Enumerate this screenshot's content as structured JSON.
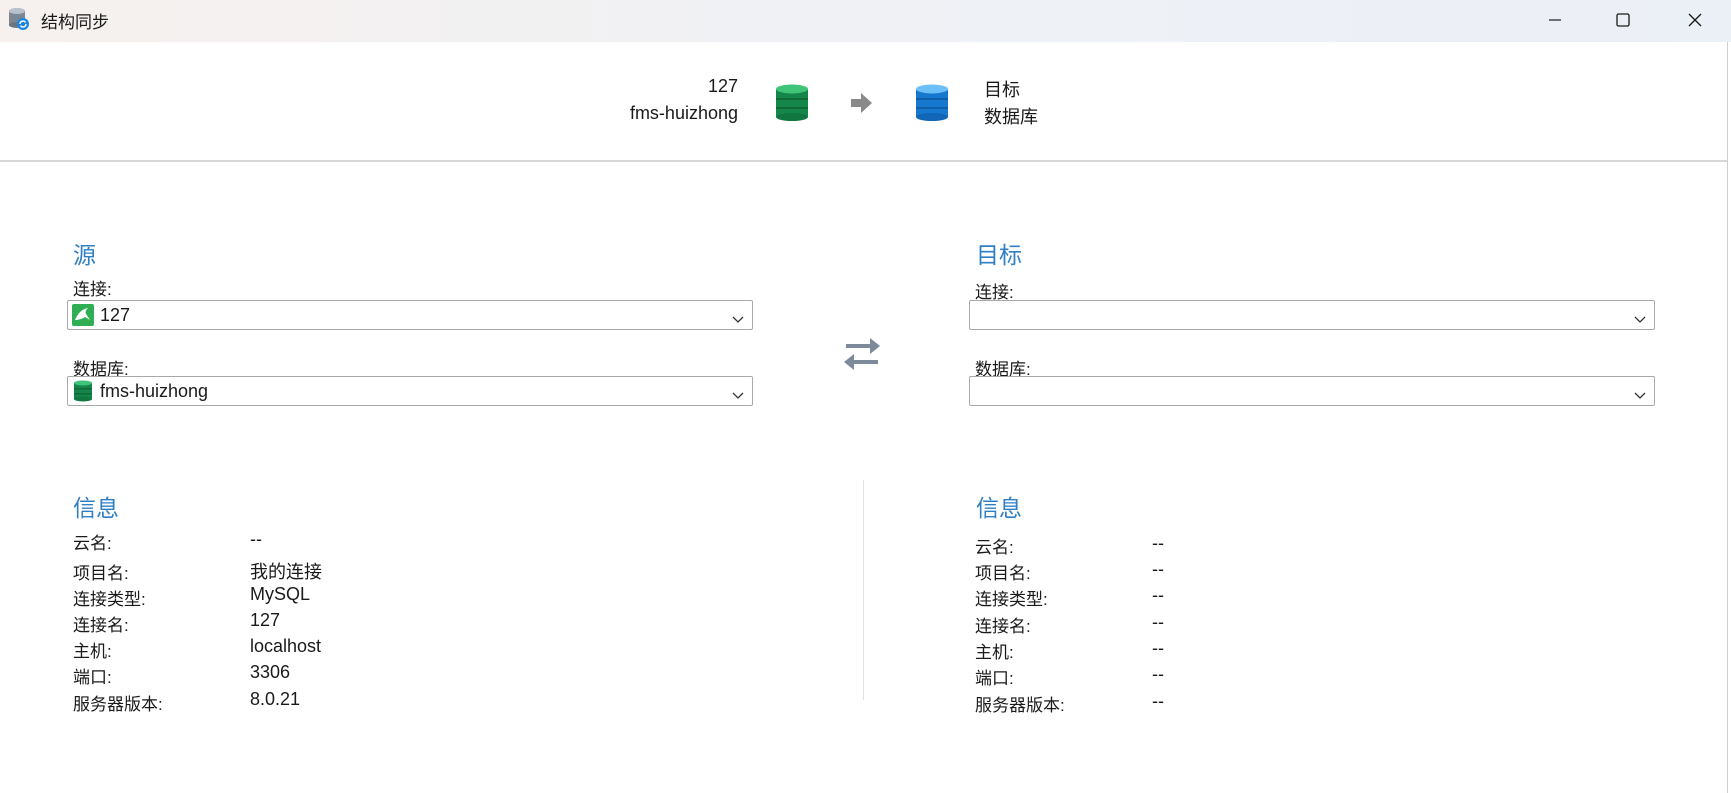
{
  "window": {
    "title": "结构同步",
    "icon": "sync-db-icon",
    "controls": [
      "minimize-icon",
      "maximize-icon",
      "close-icon"
    ]
  },
  "header": {
    "source_line1": "127",
    "source_line2": "fms-huizhong",
    "target_line1": "目标",
    "target_line2": "数据库",
    "source_db_color": "#1e9e57",
    "target_db_color": "#1f86e0",
    "arrow_color": "#8a8a8a"
  },
  "source": {
    "title": "源",
    "connection_label": "连接:",
    "connection_value": "127",
    "connection_icon": "mysql-dolphin-icon",
    "database_label": "数据库:",
    "database_value": "fms-huizhong",
    "database_icon": "database-icon"
  },
  "target": {
    "title": "目标",
    "connection_label": "连接:",
    "connection_value": "",
    "database_label": "数据库:",
    "database_value": ""
  },
  "source_info": {
    "title": "信息",
    "rows": [
      {
        "key": "云名:",
        "value": "--"
      },
      {
        "key": "项目名:",
        "value": "我的连接"
      },
      {
        "key": "连接类型:",
        "value": "MySQL"
      },
      {
        "key": "连接名:",
        "value": "127"
      },
      {
        "key": "主机:",
        "value": "localhost"
      },
      {
        "key": "端口:",
        "value": "3306"
      },
      {
        "key": "服务器版本:",
        "value": "8.0.21"
      }
    ]
  },
  "target_info": {
    "title": "信息",
    "rows": [
      {
        "key": "云名:",
        "value": "--"
      },
      {
        "key": "项目名:",
        "value": "--"
      },
      {
        "key": "连接类型:",
        "value": "--"
      },
      {
        "key": "连接名:",
        "value": "--"
      },
      {
        "key": "主机:",
        "value": "--"
      },
      {
        "key": "端口:",
        "value": "--"
      },
      {
        "key": "服务器版本:",
        "value": "--"
      }
    ]
  },
  "colors": {
    "accent": "#2f7fc4",
    "swap_icon": "#7d8a99"
  }
}
